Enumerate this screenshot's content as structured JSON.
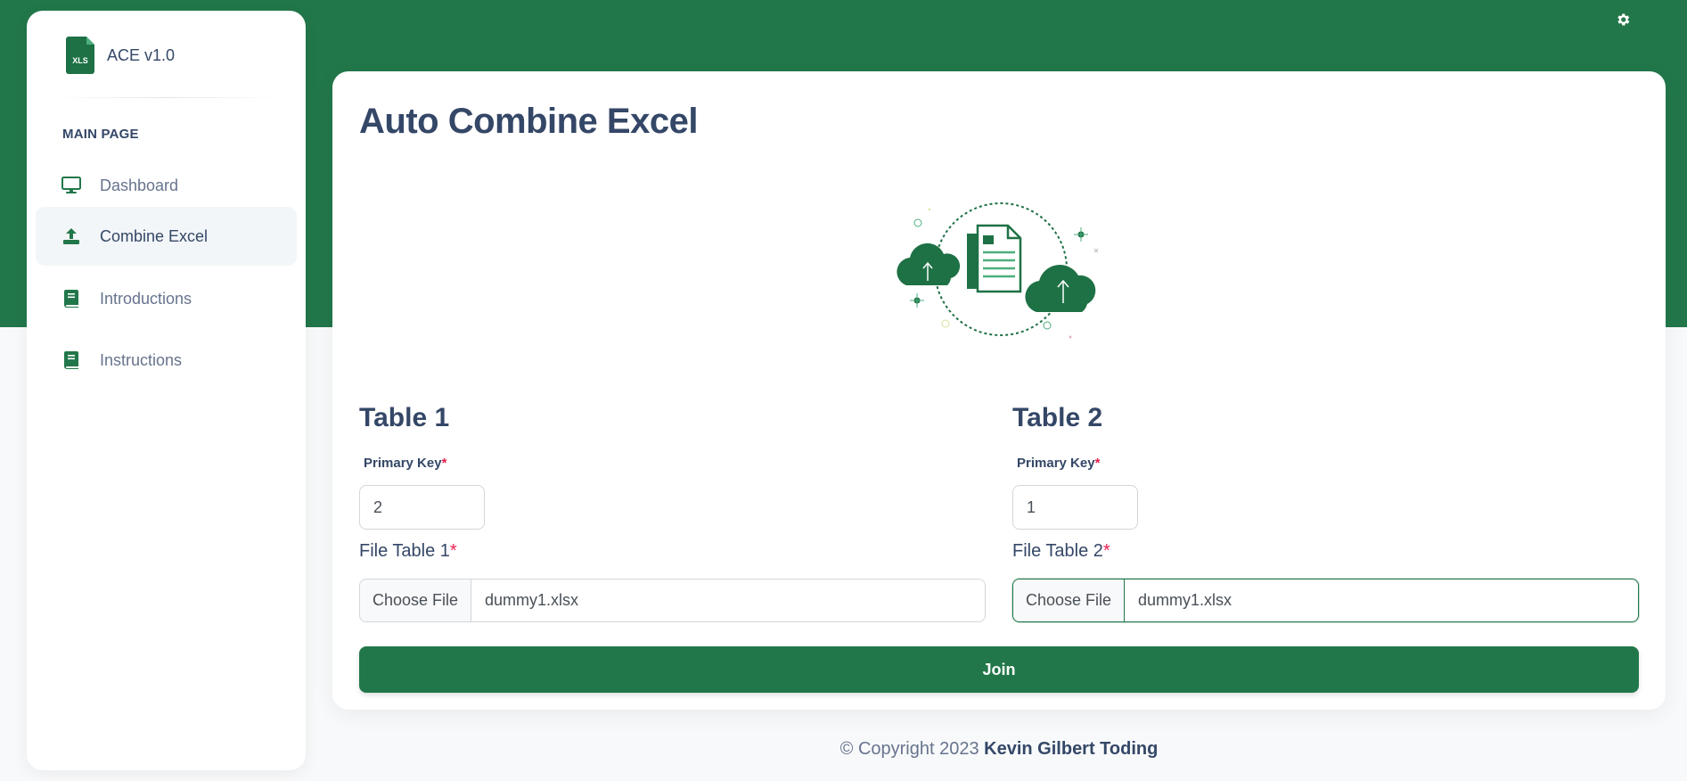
{
  "app": {
    "brand_name": "ACE v1.0",
    "logo_text": "XLS",
    "accent_color": "#22774a"
  },
  "header": {
    "settings_icon": "gear-icon"
  },
  "sidebar": {
    "section_label": "MAIN PAGE",
    "items": [
      {
        "label": "Dashboard",
        "icon": "monitor-icon",
        "active": false
      },
      {
        "label": "Combine Excel",
        "icon": "upload-icon",
        "active": true
      },
      {
        "label": "Introductions",
        "icon": "book-icon",
        "active": false
      },
      {
        "label": "Instructions",
        "icon": "book-icon",
        "active": false
      }
    ]
  },
  "main": {
    "title": "Auto Combine Excel",
    "illustration": "cloud-upload-document-illustration",
    "table1": {
      "title": "Table 1",
      "primary_key_label": "Primary Key",
      "primary_key_value": "2",
      "file_label": "File Table 1",
      "choose_file_label": "Choose File",
      "file_name": "dummy1.xlsx"
    },
    "table2": {
      "title": "Table 2",
      "primary_key_label": "Primary Key",
      "primary_key_value": "1",
      "file_label": "File Table 2",
      "choose_file_label": "Choose File",
      "file_name": "dummy1.xlsx"
    },
    "required_marker": "*",
    "join_label": "Join"
  },
  "footer": {
    "prefix": "© Copyright 2023",
    "author": "Kevin Gilbert Toding"
  }
}
